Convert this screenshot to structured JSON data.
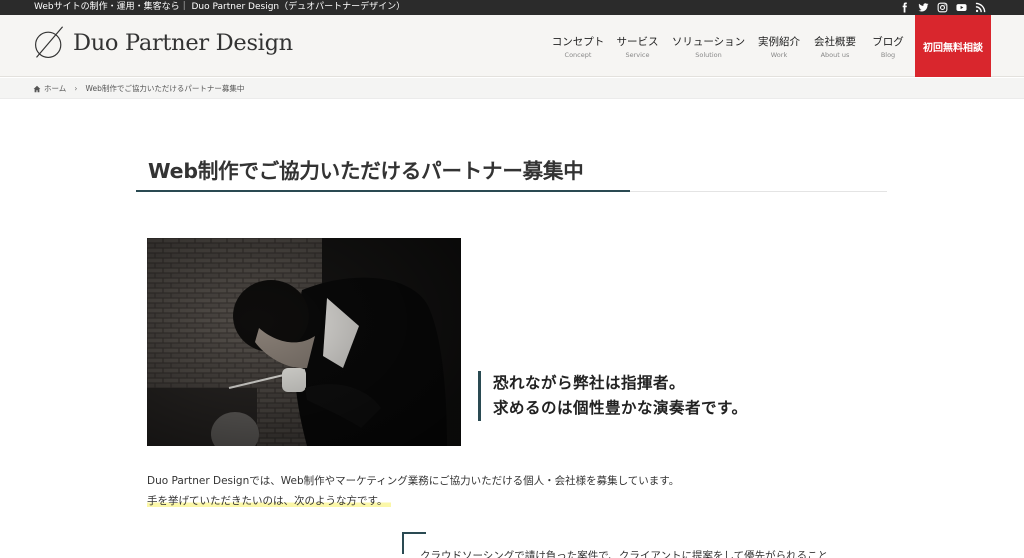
{
  "topbar": {
    "tagline": "Webサイトの制作・運用・集客なら｜ Duo Partner Design（デュオパートナーデザイン）",
    "socials": [
      "facebook-icon",
      "twitter-icon",
      "instagram-icon",
      "youtube-icon",
      "rss-icon"
    ]
  },
  "header": {
    "logo_text": "Duo Partner Design",
    "nav": [
      {
        "ja": "コンセプト",
        "en": "Concept"
      },
      {
        "ja": "サービス",
        "en": "Service"
      },
      {
        "ja": "ソリューション",
        "en": "Solution"
      },
      {
        "ja": "実例紹介",
        "en": "Work"
      },
      {
        "ja": "会社概要",
        "en": "About us"
      },
      {
        "ja": "ブログ",
        "en": "Blog"
      }
    ],
    "cta_label": "初回無料相談"
  },
  "breadcrumb": {
    "home": "ホーム",
    "separator": "›",
    "current": "Web制作でご協力いただけるパートナー募集中"
  },
  "main": {
    "title": "Web制作でご協力いただけるパートナー募集中",
    "quote_line1": "恐れながら弊社は指揮者。",
    "quote_line2": "求めるのは個性豊かな演奏者です。",
    "intro_line1": "Duo Partner Designでは、Web制作やマーケティング業務にご協力いただける個人・会社様を募集しています。",
    "intro_line2": "手を挙げていただきたいのは、次のような方です。",
    "bottom_text": "クラウドソーシングで請け負った案件で、クライアントに提案をして優先がられること"
  },
  "colors": {
    "topbar_bg": "#2b2b2b",
    "header_bg": "#f6f5f3",
    "cta_bg": "#d9262d",
    "accent": "#2a4a52",
    "highlight": "#fbf7a8"
  }
}
